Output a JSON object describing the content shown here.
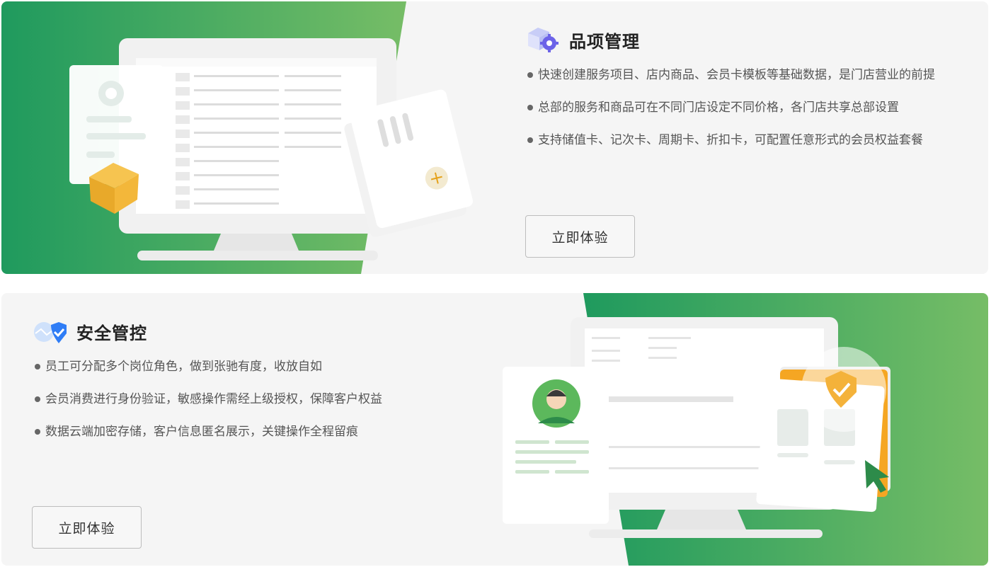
{
  "sections": [
    {
      "title": "品项管理",
      "icon": "box-gear-icon",
      "bullets": [
        "快速创建服务项目、店内商品、会员卡模板等基础数据，是门店营业的前提",
        "总部的服务和商品可在不同门店设定不同价格，各门店共享总部设置",
        "支持储值卡、记次卡、周期卡、折扣卡，可配置任意形式的会员权益套餐"
      ],
      "button_label": "立即体验"
    },
    {
      "title": "安全管控",
      "icon": "shield-check-icon",
      "bullets": [
        "员工可分配多个岗位角色，做到张驰有度，收放自如",
        "会员消费进行身份验证，敏感操作需经上级授权，保障客户权益",
        "数据云端加密存储，客户信息匿名展示，关键操作全程留痕"
      ],
      "button_label": "立即体验"
    }
  ],
  "colors": {
    "green_dark": "#1f9a5e",
    "green_light": "#76bd66",
    "card_bg": "#f5f5f5",
    "accent_orange": "#f0a62e",
    "accent_blue": "#2f7df6"
  }
}
